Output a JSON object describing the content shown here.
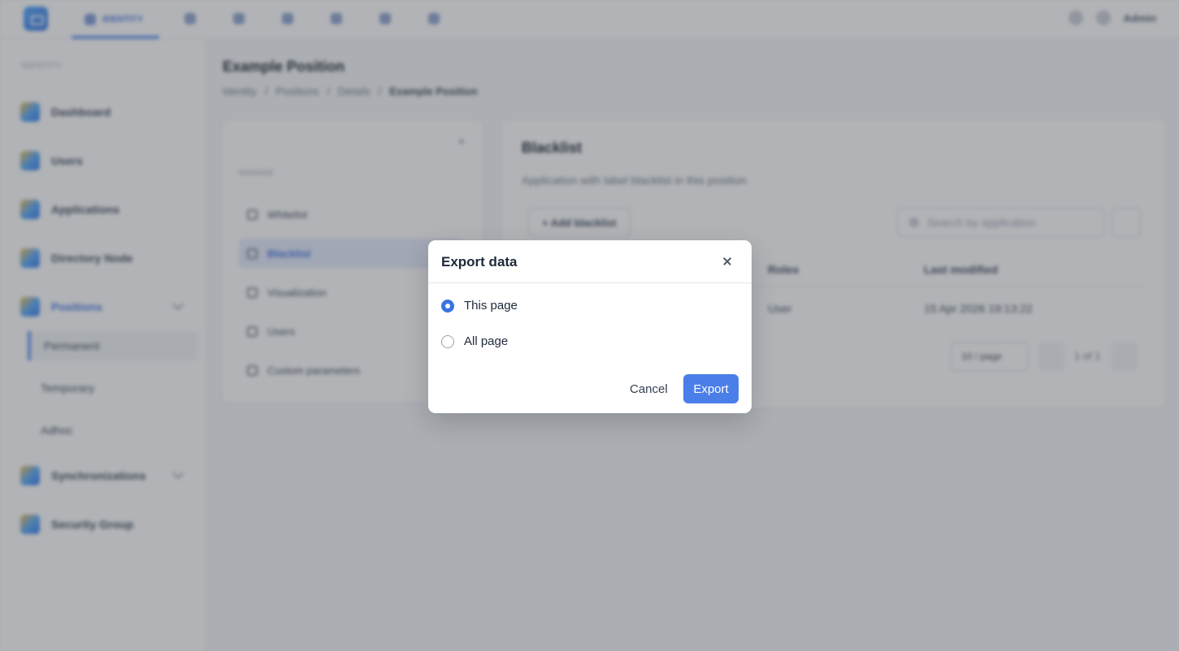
{
  "topbar": {
    "active_tab": "IDENTITY",
    "user_name": "Admin"
  },
  "sidebar": {
    "section": "IDENTITY",
    "items": [
      {
        "label": "Dashboard"
      },
      {
        "label": "Users"
      },
      {
        "label": "Applications"
      },
      {
        "label": "Directory Node"
      },
      {
        "label": "Positions"
      },
      {
        "label": "Synchronizations"
      },
      {
        "label": "Security Group"
      }
    ],
    "positions_sub": [
      {
        "label": "Permanent"
      },
      {
        "label": "Temporary"
      },
      {
        "label": "Adhoc"
      }
    ]
  },
  "main": {
    "title": "Example Position",
    "breadcrumbs": [
      "Identity",
      "/",
      "Positions",
      "/",
      "Details",
      "/",
      "Example Position"
    ],
    "left_menu": {
      "section": "MANAGE",
      "items": [
        {
          "label": "Whitelist"
        },
        {
          "label": "Blacklist"
        },
        {
          "label": "Visualization"
        },
        {
          "label": "Users"
        },
        {
          "label": "Custom parameters"
        }
      ]
    },
    "blacklist": {
      "title": "Blacklist",
      "description": "Application with label blacklist in this position",
      "add_button": "+ Add blacklist",
      "search_placeholder": "Search by application",
      "columns": [
        "Roles",
        "Last modified"
      ],
      "row": [
        "User",
        "15 Apr 2026 19:13:22"
      ],
      "per_page": "10 / page",
      "page_info": "1 of 1"
    }
  },
  "modal": {
    "title": "Export data",
    "options": [
      {
        "label": "This page",
        "checked": true
      },
      {
        "label": "All page",
        "checked": false
      }
    ],
    "cancel_label": "Cancel",
    "export_label": "Export",
    "accent_color": "#4a7ee8"
  }
}
